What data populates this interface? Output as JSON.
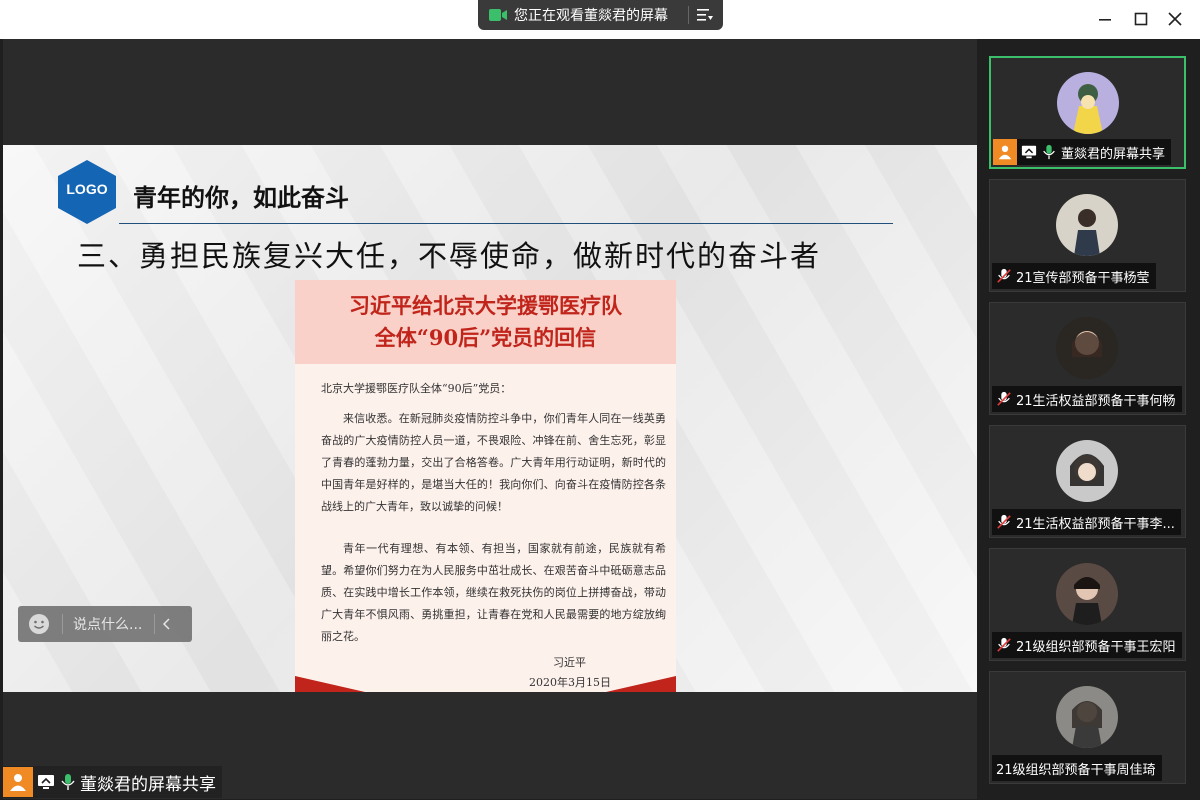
{
  "window": {
    "share_banner": "您正在观看董燚君的屏幕",
    "accent_green": "#3bbf6a",
    "accent_orange": "#f08a24"
  },
  "slide": {
    "logo": "LOGO",
    "heading": "青年的你，如此奋斗",
    "subheading": "三、勇担民族复兴大任，不辱使命，做新时代的奋斗者"
  },
  "letter": {
    "title_line1": "习近平给北京大学援鄂医疗队",
    "title_line2": "全体“90后”党员的回信",
    "salutation": "北京大学援鄂医疗队全体“90后”党员：",
    "paragraph1": "来信收悉。在新冠肺炎疫情防控斗争中，你们青年人同在一线英勇奋战的广大疫情防控人员一道，不畏艰险、冲锋在前、舍生忘死，彰显了青春的蓬勃力量，交出了合格答卷。广大青年用行动证明，新时代的中国青年是好样的，是堪当大任的！我向你们、向奋斗在疫情防控各条战线上的广大青年，致以诚挚的问候！",
    "paragraph2": "青年一代有理想、有本领、有担当，国家就有前途，民族就有希望。希望你们努力在为人民服务中茁壮成长、在艰苦奋斗中砥砺意志品质、在实践中增长工作本领，继续在救死扶伤的岗位上拼搏奋战，带动广大青年不惧风雨、勇挑重担，让青春在党和人民最需要的地方绽放绚丽之花。",
    "signature": "习近平",
    "date": "2020年3月15日"
  },
  "chat": {
    "placeholder": "说点什么..."
  },
  "self_label": "董燚君的屏幕共享",
  "participants": [
    {
      "name": "董燚君的屏幕共享",
      "muted": false,
      "sharing": true
    },
    {
      "name": "21宣传部预备干事杨莹",
      "muted": true,
      "sharing": false
    },
    {
      "name": "21生活权益部预备干事何畅",
      "muted": true,
      "sharing": false
    },
    {
      "name": "21生活权益部预备干事李...",
      "muted": true,
      "sharing": false
    },
    {
      "name": "21级组织部预备干事王宏阳",
      "muted": true,
      "sharing": false
    },
    {
      "name": "21级组织部预备干事周佳琦",
      "muted": false,
      "sharing": false
    }
  ]
}
